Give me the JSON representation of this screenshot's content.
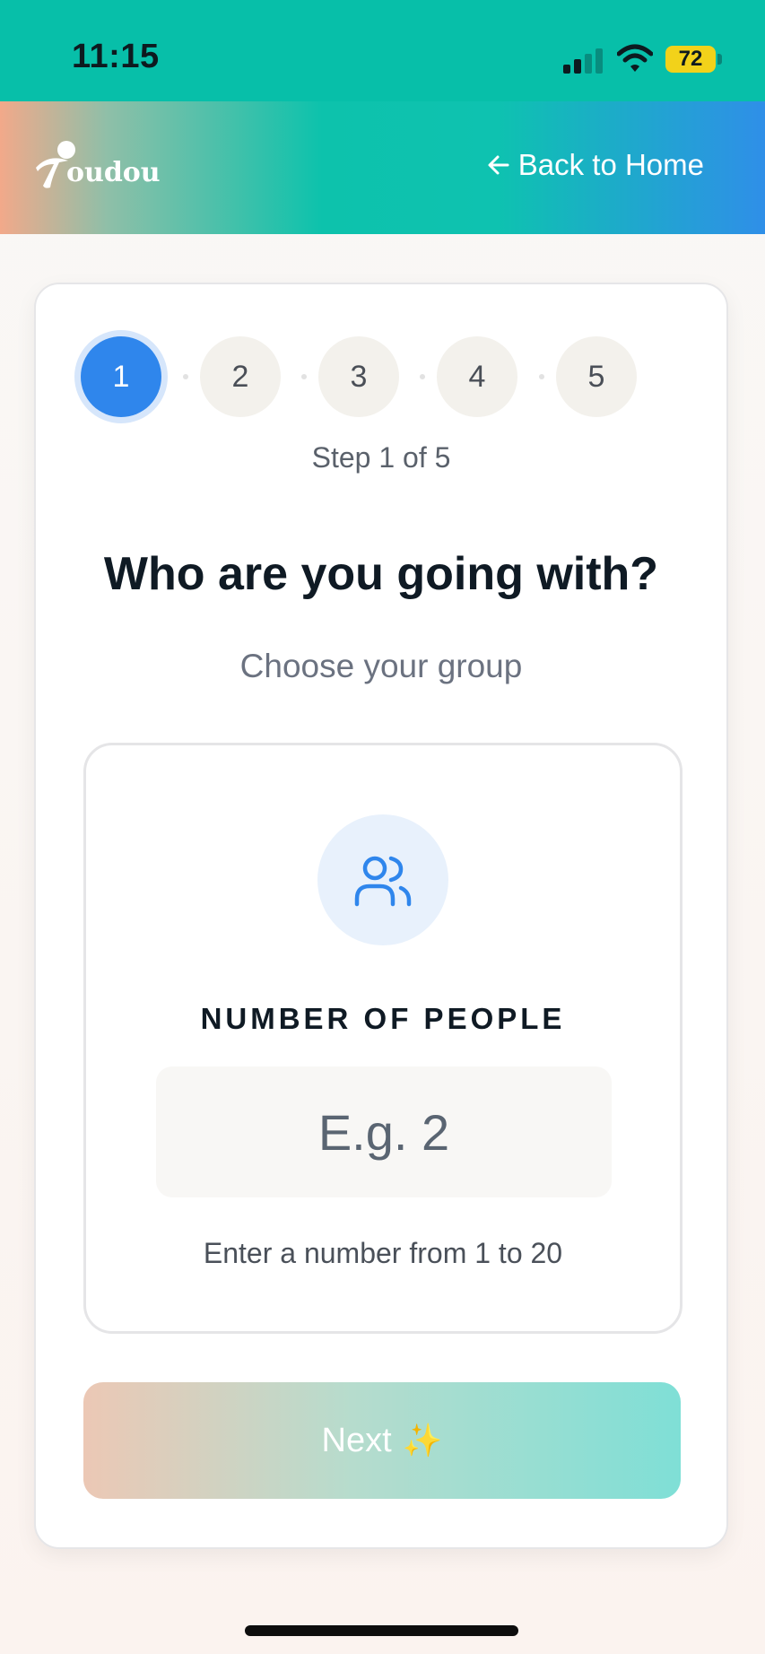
{
  "status_bar": {
    "time": "11:15",
    "battery": "72",
    "battery_color": "#f2d21a"
  },
  "header": {
    "logo_text": "oudou",
    "back_label": "Back to Home",
    "back_icon": "arrow-left-icon"
  },
  "progress": {
    "steps": [
      "1",
      "2",
      "3",
      "4",
      "5"
    ],
    "active_step": 1,
    "counter": "Step 1 of 5",
    "active_color": "#2f86ec"
  },
  "question": {
    "title": "Who are you going with?",
    "subtitle": "Choose your group"
  },
  "group_field": {
    "icon": "users-icon",
    "label": "NUMBER OF PEOPLE",
    "value": "",
    "placeholder": "E.g. 2",
    "hint": "Enter a number from 1 to 20"
  },
  "actions": {
    "next_label": "Next",
    "next_icon": "sparkles-icon",
    "next_glyph": "✨"
  }
}
